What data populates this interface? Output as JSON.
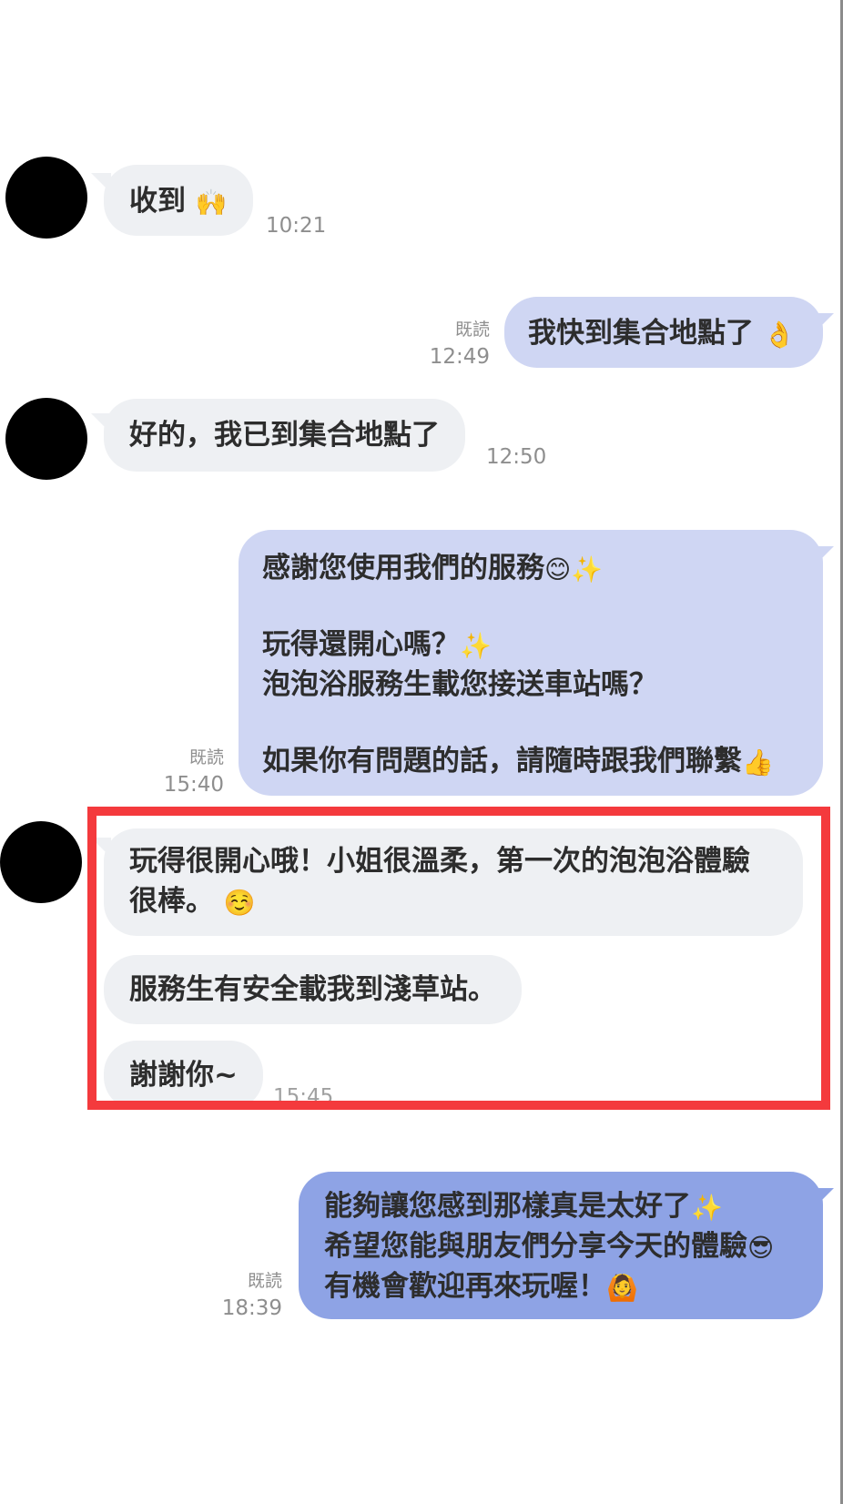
{
  "messages": {
    "m1": {
      "text": "收到",
      "emoji": "🙌",
      "time": "10:21"
    },
    "m2": {
      "text": "我快到集合地點了",
      "emoji": "👌",
      "read": "既読",
      "time": "12:49"
    },
    "m3": {
      "text": "好的，我已到集合地點了",
      "time": "12:50"
    },
    "m4": {
      "line1": "感謝您使用我們的服務",
      "line1_emoji": "😊✨",
      "line2": "玩得還開心嗎？",
      "line2_emoji": "✨",
      "line3": "泡泡浴服務生載您接送車站嗎？",
      "line4": "如果你有問題的話，請隨時跟我們聯繫",
      "line4_emoji": "👍",
      "read": "既読",
      "time": "15:40"
    },
    "m5": {
      "line1": "玩得很開心哦！小姐很溫柔，第一次的泡泡浴體驗",
      "line2": "很棒。",
      "emoji": "☺️"
    },
    "m6": {
      "text": "服務生有安全載我到淺草站。"
    },
    "m7": {
      "text": "謝謝你~",
      "time": "15:45"
    },
    "m8": {
      "line1": "能夠讓您感到那樣真是太好了",
      "line1_emoji": "✨",
      "line2": "希望您能與朋友們分享今天的體驗",
      "line2_emoji": "😎",
      "line3_a": "有機會",
      "line3_b": "歡迎再來玩",
      "line3_c": "喔！",
      "line3_emoji": "🙆",
      "read": "既読",
      "time": "18:39"
    }
  },
  "colors": {
    "received_bubble": "#eef0f3",
    "sent_bubble": "#cfd6f3",
    "sent_bubble_highlight": "#8ea3e5",
    "highlight_border": "#f43a3d"
  }
}
